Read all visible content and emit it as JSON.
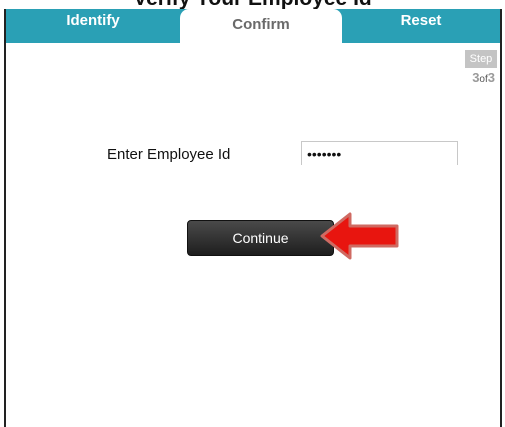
{
  "header": {
    "cut_title": "Verify Your Employee Id"
  },
  "tabs": [
    {
      "label": "Identify",
      "active": false
    },
    {
      "label": "Confirm",
      "active": true
    },
    {
      "label": "Reset",
      "active": false
    }
  ],
  "step": {
    "badge": "Step",
    "current": "3",
    "of_label": "of",
    "total": "3"
  },
  "form": {
    "employee_label": "Enter Employee Id",
    "employee_value": "•••••••",
    "continue_label": "Continue"
  },
  "colors": {
    "tab_bar": "#2aa0b5",
    "arrow": "#e8150f",
    "button": "#2b2b2b"
  },
  "icons": {
    "annotation": "red-arrow-pointing-left"
  }
}
